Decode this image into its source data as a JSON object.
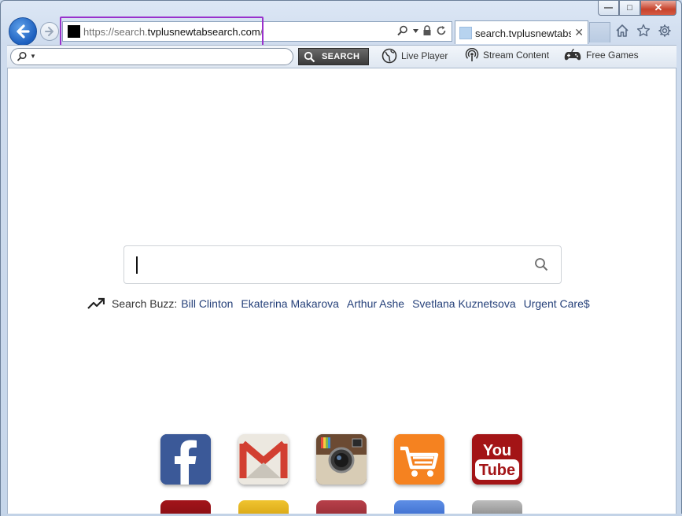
{
  "window": {
    "caption_buttons": {
      "minimize": "—",
      "maximize": "□",
      "close": "✕"
    }
  },
  "address_bar": {
    "url_prefix": "https://",
    "url_sub": "search.",
    "url_domain": "tvplusnewtabsearch.com",
    "url_suffix": "/",
    "highlight_color": "#9932cc"
  },
  "tab": {
    "title": "search.tvplusnewtabs...",
    "close": "✕"
  },
  "toolbar": {
    "search_placeholder": "",
    "search_button": "SEARCH",
    "links": [
      {
        "label": "Live Player",
        "icon": "globe-icon"
      },
      {
        "label": "Stream Content",
        "icon": "broadcast-icon"
      },
      {
        "label": "Free Games",
        "icon": "gamepad-icon"
      }
    ]
  },
  "main_search": {
    "placeholder": ""
  },
  "search_buzz": {
    "label": "Search Buzz:",
    "items": [
      "Bill Clinton",
      "Ekaterina Makarova",
      "Arthur Ashe",
      "Svetlana Kuznetsova",
      "Urgent Care$"
    ]
  },
  "apps": [
    {
      "name": "Facebook",
      "color": "#3b5998"
    },
    {
      "name": "Gmail",
      "color": "#e6e2da"
    },
    {
      "name": "Instagram",
      "color": "#6b4a32"
    },
    {
      "name": "Shopping",
      "color": "#f58220"
    },
    {
      "name": "YouTube",
      "color": "#9e1214",
      "text_top": "You",
      "text_bottom": "Tube"
    }
  ],
  "apps_row2_colors": [
    "#a3141a",
    "#e6b81e",
    "#a8343e",
    "#4e7fd9",
    "#9a9a9a"
  ]
}
